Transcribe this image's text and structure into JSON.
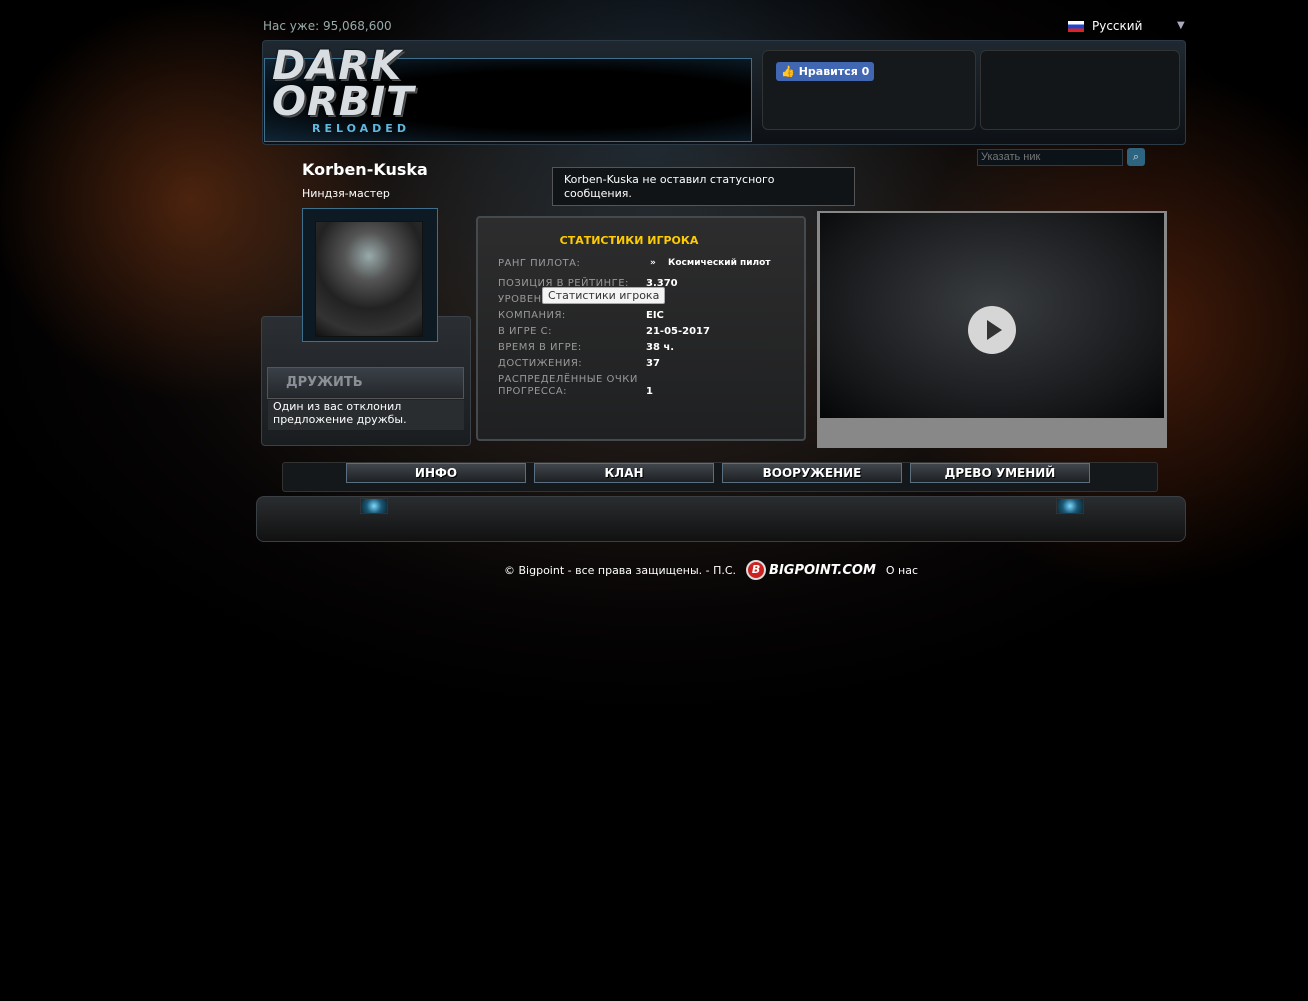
{
  "header": {
    "counter": "Нас уже: 95,068,600",
    "language": "Русский",
    "logo_line1": "DARK",
    "logo_line2": "ORBIT",
    "logo_sub": "RELOADED",
    "like_label": "Нравится 0",
    "search_placeholder": "Указать ник"
  },
  "player": {
    "name": "Korben-Kuska",
    "title": "Ниндзя-мастер",
    "status": "Korben-Kuska не оставил статусного сообщения.",
    "friend_button": "ДРУЖИТЬ",
    "friend_message": "Один из вас отклонил предложение дружбы."
  },
  "stats": {
    "title": "СТАТИСТИКИ ИГРОКА",
    "tooltip": "Статистики игрока",
    "rows": [
      {
        "label": "РАНГ ПИЛОТА:",
        "value": "Космический пилот"
      },
      {
        "label": "ПОЗИЦИЯ В РЕЙТИНГЕ:",
        "value": "3.370"
      },
      {
        "label": "УРОВЕНЬ:",
        "value": ""
      },
      {
        "label": "КОМПАНИЯ:",
        "value": "EIC"
      },
      {
        "label": "В ИГРЕ С:",
        "value": "21-05-2017"
      },
      {
        "label": "ВРЕМЯ В ИГРЕ:",
        "value": "38 ч."
      },
      {
        "label": "ДОСТИЖЕНИЯ:",
        "value": "37"
      },
      {
        "label": "РАСПРЕДЕЛЁННЫЕ ОЧКИ ПРОГРЕССА:",
        "value": "1"
      }
    ]
  },
  "tabs": [
    "ИНФО",
    "КЛАН",
    "ВООРУЖЕНИЕ",
    "ДРЕВО УМЕНИЙ"
  ],
  "footer": {
    "copyright": "© Bigpoint - все права защищены. - П.С.",
    "brand": "BIGPOINT.COM",
    "about": "О нас"
  }
}
